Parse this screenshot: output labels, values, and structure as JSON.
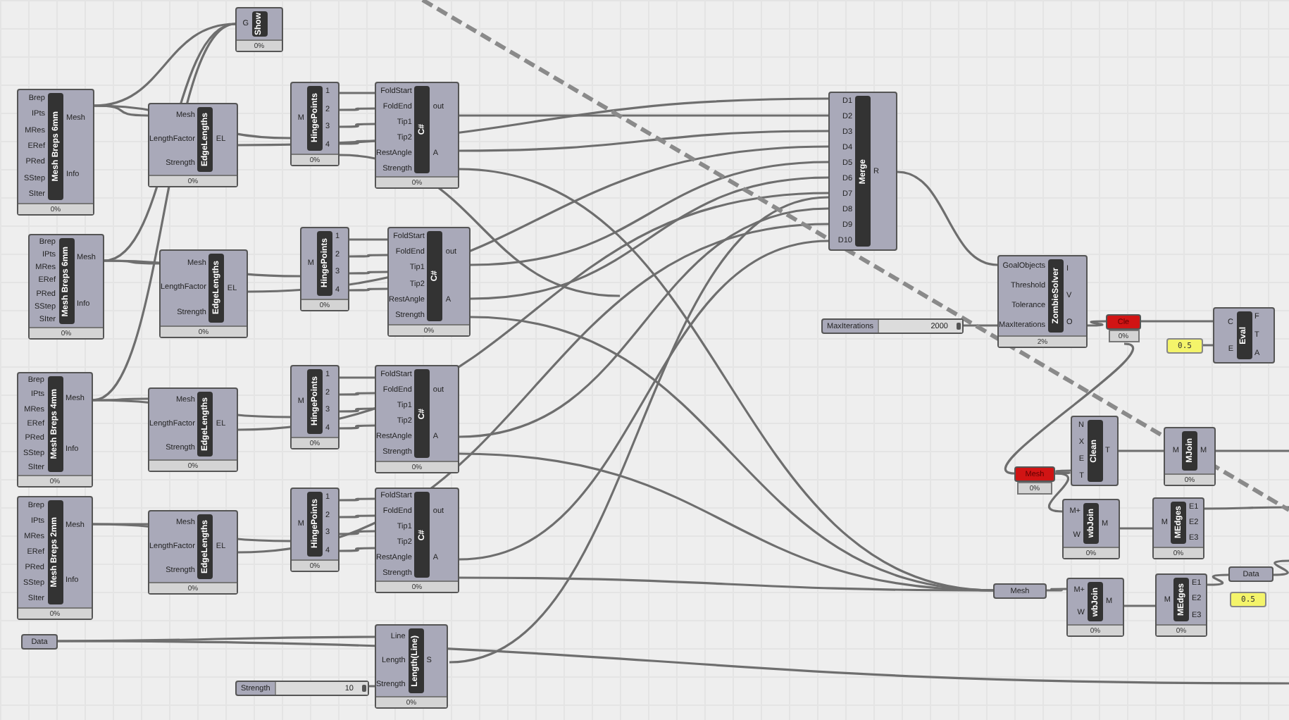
{
  "components": [
    {
      "title": "Show",
      "inputs": [
        "G"
      ],
      "progress": "0%"
    },
    {
      "title": "Mesh Breps 6mm",
      "inputs": [
        "Brep",
        "IPts",
        "MRes",
        "ERef",
        "PRed",
        "SStep",
        "SIter"
      ],
      "outputs": [
        "Mesh",
        "Info"
      ],
      "progress": "0%"
    },
    {
      "title": "Mesh Breps 6mm",
      "inputs": [
        "Brep",
        "IPts",
        "MRes",
        "ERef",
        "PRed",
        "SStep",
        "SIter"
      ],
      "outputs": [
        "Mesh",
        "Info"
      ],
      "progress": "0%"
    },
    {
      "title": "Mesh Breps 4mm",
      "inputs": [
        "Brep",
        "IPts",
        "MRes",
        "ERef",
        "PRed",
        "SStep",
        "SIter"
      ],
      "outputs": [
        "Mesh",
        "Info"
      ],
      "progress": "0%"
    },
    {
      "title": "Mesh Breps 2mm",
      "inputs": [
        "Brep",
        "IPts",
        "MRes",
        "ERef",
        "PRed",
        "SStep",
        "SIter"
      ],
      "outputs": [
        "Mesh",
        "Info"
      ],
      "progress": "0%"
    },
    {
      "title": "EdgeLengths",
      "inputs": [
        "Mesh",
        "LengthFactor",
        "Strength"
      ],
      "outputs": [
        "EL"
      ],
      "progress": "0%"
    },
    {
      "title": "EdgeLengths",
      "inputs": [
        "Mesh",
        "LengthFactor",
        "Strength"
      ],
      "outputs": [
        "EL"
      ],
      "progress": "0%"
    },
    {
      "title": "EdgeLengths",
      "inputs": [
        "Mesh",
        "LengthFactor",
        "Strength"
      ],
      "outputs": [
        "EL"
      ],
      "progress": "0%"
    },
    {
      "title": "EdgeLengths",
      "inputs": [
        "Mesh",
        "LengthFactor",
        "Strength"
      ],
      "outputs": [
        "EL"
      ],
      "progress": "0%"
    },
    {
      "title": "HingePoints",
      "inputs": [
        "M"
      ],
      "outputs": [
        "1",
        "2",
        "3",
        "4"
      ],
      "progress": "0%"
    },
    {
      "title": "HingePoints",
      "inputs": [
        "M"
      ],
      "outputs": [
        "1",
        "2",
        "3",
        "4"
      ],
      "progress": "0%"
    },
    {
      "title": "HingePoints",
      "inputs": [
        "M"
      ],
      "outputs": [
        "1",
        "2",
        "3",
        "4"
      ],
      "progress": "0%"
    },
    {
      "title": "HingePoints",
      "inputs": [
        "M"
      ],
      "outputs": [
        "1",
        "2",
        "3",
        "4"
      ],
      "progress": "0%"
    },
    {
      "title": "C#",
      "inputs": [
        "FoldStart",
        "FoldEnd",
        "Tip1",
        "Tip2",
        "RestAngle",
        "Strength"
      ],
      "outputs": [
        "out",
        "A"
      ],
      "progress": "0%"
    },
    {
      "title": "C#",
      "inputs": [
        "FoldStart",
        "FoldEnd",
        "Tip1",
        "Tip2",
        "RestAngle",
        "Strength"
      ],
      "outputs": [
        "out",
        "A"
      ],
      "progress": "0%"
    },
    {
      "title": "C#",
      "inputs": [
        "FoldStart",
        "FoldEnd",
        "Tip1",
        "Tip2",
        "RestAngle",
        "Strength"
      ],
      "outputs": [
        "out",
        "A"
      ],
      "progress": "0%"
    },
    {
      "title": "C#",
      "inputs": [
        "FoldStart",
        "FoldEnd",
        "Tip1",
        "Tip2",
        "RestAngle",
        "Strength"
      ],
      "outputs": [
        "out",
        "A"
      ],
      "progress": "0%"
    },
    {
      "title": "Merge",
      "inputs": [
        "D1",
        "D2",
        "D3",
        "D4",
        "D5",
        "D6",
        "D7",
        "D8",
        "D9",
        "D10"
      ],
      "outputs": [
        "R"
      ]
    },
    {
      "title": "ZombieSolver",
      "inputs": [
        "GoalObjects",
        "Threshold",
        "Tolerance",
        "MaxIterations"
      ],
      "outputs": [
        "I",
        "V",
        "O"
      ],
      "progress": "2%"
    },
    {
      "title": "Eval",
      "inputs": [
        "C",
        "E"
      ],
      "outputs": [
        "F",
        "T",
        "A"
      ]
    },
    {
      "title": "Clean",
      "inputs": [
        "N",
        "X",
        "E",
        "T"
      ],
      "outputs": [
        "T"
      ]
    },
    {
      "title": "MJoin",
      "inputs": [
        "M"
      ],
      "outputs": [
        "M"
      ],
      "progress": "0%"
    },
    {
      "title": "wbJoin",
      "inputs": [
        "M+",
        "W"
      ],
      "outputs": [
        "M"
      ],
      "progress": "0%"
    },
    {
      "title": "MEdges",
      "inputs": [
        "M"
      ],
      "outputs": [
        "E1",
        "E2",
        "E3"
      ],
      "progress": "0%"
    },
    {
      "title": "wbJoin",
      "inputs": [
        "M+",
        "W"
      ],
      "outputs": [
        "M"
      ],
      "progress": "0%"
    },
    {
      "title": "MEdges",
      "inputs": [
        "M"
      ],
      "outputs": [
        "E1",
        "E2",
        "E3"
      ],
      "progress": "0%"
    },
    {
      "title": "Length(Line)",
      "inputs": [
        "Line",
        "Length",
        "Strength"
      ],
      "outputs": [
        "S"
      ],
      "progress": "0%"
    }
  ],
  "params": [
    {
      "kind": "param",
      "label": "Data"
    },
    {
      "kind": "param",
      "label": "Mesh"
    },
    {
      "kind": "param",
      "label": "Data"
    },
    {
      "kind": "error",
      "label": "Cle",
      "progress": "0%"
    },
    {
      "kind": "error",
      "label": "Mesh",
      "progress": "0%"
    },
    {
      "kind": "panel",
      "label": "0.5"
    },
    {
      "kind": "panel",
      "label": "0.5"
    },
    {
      "kind": "slider",
      "label": "MaxIterations",
      "value": "2000",
      "level": 0.95
    },
    {
      "kind": "slider",
      "label": "Strength",
      "value": "10",
      "level": 0.95
    }
  ]
}
